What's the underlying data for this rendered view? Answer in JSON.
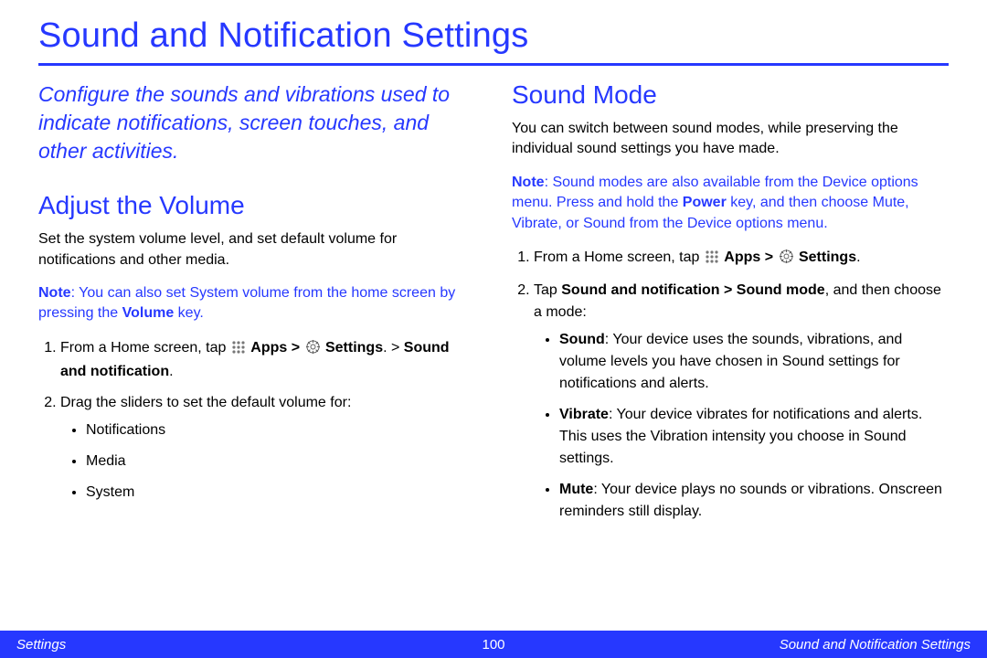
{
  "title": "Sound and Notification Settings",
  "intro": "Configure the sounds and vibrations used to indicate notifications, screen touches, and other activities.",
  "left": {
    "heading": "Adjust the Volume",
    "desc": "Set the system volume level, and set default volume for notifications and other media.",
    "note_label": "Note",
    "note_pre": ": You can also set System volume from the home screen by pressing the ",
    "note_bold": "Volume",
    "note_post": " key.",
    "step1_pre": "From a Home screen, tap ",
    "step1_apps": "Apps > ",
    "step1_settings": "Settings",
    "step1_post1": ". > ",
    "step1_bold2": "Sound and notification",
    "step1_post2": ".",
    "step2": "Drag the sliders to set the default volume for:",
    "bul1": "Notifications",
    "bul2": "Media",
    "bul3": "System"
  },
  "right": {
    "heading": "Sound Mode",
    "desc": "You can switch between sound modes, while preserving the individual sound settings you have made.",
    "note_label": "Note",
    "note_pre": ": Sound modes are also available from the Device options menu. Press and hold the ",
    "note_bold": "Power",
    "note_post": " key, and then choose Mute, Vibrate, or Sound from the Device options menu.",
    "step1_pre": "From a Home screen, tap ",
    "step1_apps": "Apps > ",
    "step1_settings": "Settings",
    "step1_post": ".",
    "step2_pre": "Tap ",
    "step2_bold": "Sound and notification > Sound mode",
    "step2_post": ", and then choose a mode:",
    "mode1_b": "Sound",
    "mode1": ": Your device uses the sounds, vibrations, and volume levels you have chosen in Sound settings for notifications and alerts.",
    "mode2_b": "Vibrate",
    "mode2": ": Your device vibrates for notifications and alerts. This uses the Vibration intensity you choose in Sound settings.",
    "mode3_b": "Mute",
    "mode3": ": Your device plays no sounds or vibrations. Onscreen reminders still display."
  },
  "footer": {
    "left": "Settings",
    "page": "100",
    "right": "Sound and Notification Settings"
  }
}
